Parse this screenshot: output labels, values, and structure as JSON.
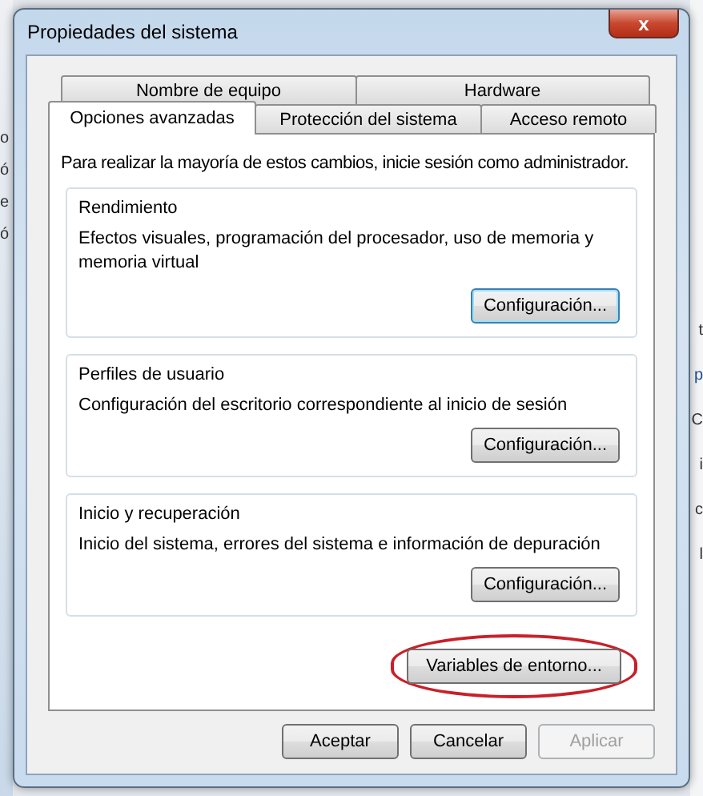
{
  "background_window": {
    "left_fragments": [
      "o",
      "ó",
      "e",
      "ó"
    ],
    "right_fragments": [
      "t",
      "p",
      "C",
      "i",
      "c",
      "l"
    ]
  },
  "window": {
    "title": "Propiedades del sistema",
    "close": "x"
  },
  "tab_rows": [
    [
      {
        "label": "Nombre de equipo",
        "selected": false
      },
      {
        "label": "Hardware",
        "selected": false
      }
    ],
    [
      {
        "label": "Opciones avanzadas",
        "selected": true
      },
      {
        "label": "Protección del sistema",
        "selected": false
      },
      {
        "label": "Acceso remoto",
        "selected": false
      }
    ]
  ],
  "intro": "Para realizar la mayoría de estos cambios, inicie sesión como administrador.",
  "groups": [
    {
      "title": "Rendimiento",
      "text": "Efectos visuales, programación del procesador, uso de memoria y memoria virtual",
      "button": "Configuración..."
    },
    {
      "title": "Perfiles de usuario",
      "text": "Configuración del escritorio correspondiente al inicio de sesión",
      "button": "Configuración..."
    },
    {
      "title": "Inicio y recuperación",
      "text": "Inicio del sistema, errores del sistema e información de depuración",
      "button": "Configuración..."
    }
  ],
  "env_button": {
    "label": "Variables de entorno...",
    "highlighted": true
  },
  "buttons": [
    {
      "label": "Aceptar",
      "disabled": false
    },
    {
      "label": "Cancelar",
      "disabled": false
    },
    {
      "label": "Aplicar",
      "disabled": true
    }
  ]
}
